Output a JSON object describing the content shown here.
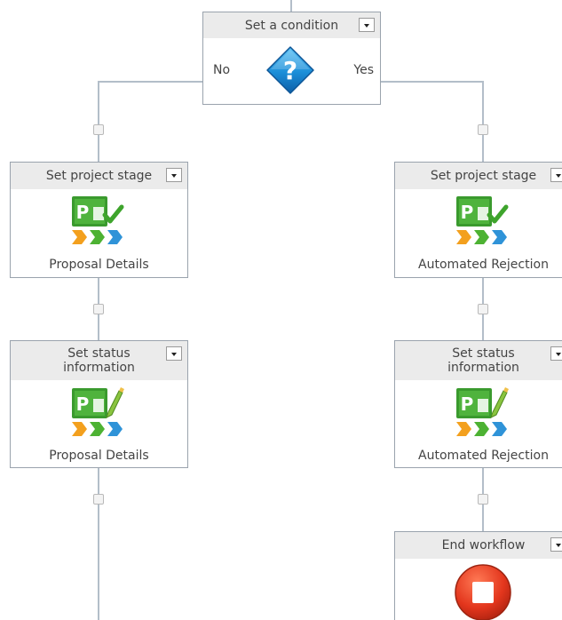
{
  "condition": {
    "title": "Set a condition",
    "no_label": "No",
    "yes_label": "Yes",
    "icon": "question-diamond-icon"
  },
  "left_branch": {
    "stage": {
      "title": "Set project stage",
      "caption": "Proposal Details",
      "icon": "project-stage-icon"
    },
    "status": {
      "title_line1": "Set status",
      "title_line2": "information",
      "caption": "Proposal Details",
      "icon": "status-information-icon"
    }
  },
  "right_branch": {
    "stage": {
      "title": "Set project stage",
      "caption": "Automated Rejection",
      "icon": "project-stage-icon"
    },
    "status": {
      "title_line1": "Set status",
      "title_line2": "information",
      "caption": "Automated Rejection",
      "icon": "status-information-icon"
    },
    "end": {
      "title": "End workflow",
      "icon": "stop-icon"
    }
  },
  "colors": {
    "connector": "#b3bec9",
    "header_bg": "#ebebeb",
    "node_border": "#9aa3ad",
    "stop_red": "#e3361d"
  }
}
